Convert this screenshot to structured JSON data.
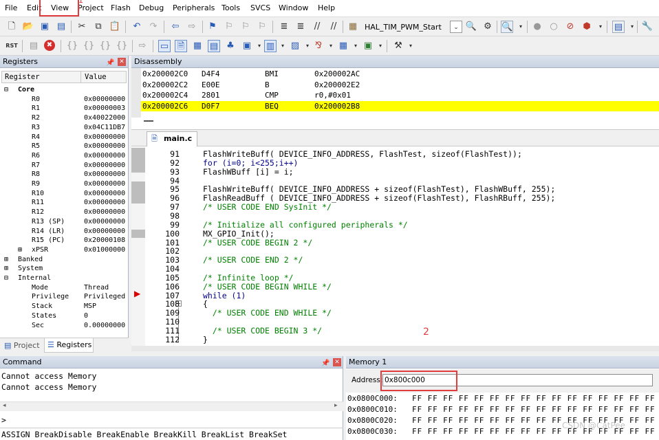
{
  "menu": {
    "items": [
      "File",
      "Edit",
      "View",
      "Project",
      "Flash",
      "Debug",
      "Peripherals",
      "Tools",
      "SVCS",
      "Window",
      "Help"
    ],
    "annotation_1": "1"
  },
  "toolbar": {
    "target_name": "HAL_TIM_PWM_Start"
  },
  "registers_panel": {
    "title": "Registers",
    "col_register": "Register",
    "col_value": "Value",
    "rows": [
      {
        "name": "Core",
        "value": "",
        "type": "group-open"
      },
      {
        "name": "R0",
        "value": "0x00000000"
      },
      {
        "name": "R1",
        "value": "0x00000003"
      },
      {
        "name": "R2",
        "value": "0x40022000"
      },
      {
        "name": "R3",
        "value": "0x04C11DB7"
      },
      {
        "name": "R4",
        "value": "0x00000000"
      },
      {
        "name": "R5",
        "value": "0x00000000"
      },
      {
        "name": "R6",
        "value": "0x00000000"
      },
      {
        "name": "R7",
        "value": "0x00000000"
      },
      {
        "name": "R8",
        "value": "0x00000000"
      },
      {
        "name": "R9",
        "value": "0x00000000"
      },
      {
        "name": "R10",
        "value": "0x00000000"
      },
      {
        "name": "R11",
        "value": "0x00000000"
      },
      {
        "name": "R12",
        "value": "0x00000000"
      },
      {
        "name": "R13 (SP)",
        "value": "0x00000000"
      },
      {
        "name": "R14 (LR)",
        "value": "0x00000000"
      },
      {
        "name": "R15 (PC)",
        "value": "0x20000108"
      },
      {
        "name": "xPSR",
        "value": "0x01000000"
      },
      {
        "name": "Banked",
        "value": ""
      },
      {
        "name": "System",
        "value": ""
      },
      {
        "name": "Internal",
        "value": ""
      },
      {
        "name": "Mode",
        "value": "Thread"
      },
      {
        "name": "Privilege",
        "value": "Privileged"
      },
      {
        "name": "Stack",
        "value": "MSP"
      },
      {
        "name": "States",
        "value": "0"
      },
      {
        "name": "Sec",
        "value": "0.00000000"
      }
    ],
    "tab_project": "Project",
    "tab_registers": "Registers"
  },
  "disassembly": {
    "title": "Disassembly",
    "rows": [
      {
        "addr": "0x200002C0",
        "op": "D4F4",
        "mnem": "BMI",
        "arg": "0x200002AC",
        "highlight": false
      },
      {
        "addr": "0x200002C2",
        "op": "E00E",
        "mnem": "B",
        "arg": "0x200002E2",
        "highlight": false
      },
      {
        "addr": "0x200002C4",
        "op": "2801",
        "mnem": "CMP",
        "arg": "r0,#0x01",
        "highlight": false
      },
      {
        "addr": "0x200002C6",
        "op": "D0F7",
        "mnem": "BEQ",
        "arg": "0x200002B8",
        "highlight": true
      }
    ]
  },
  "editor": {
    "tab": "main.c",
    "lines": [
      {
        "n": "91",
        "t": "FlashWriteBuff( DEVICE_INFO_ADDRESS, FlashTest, sizeof(FlashTest));"
      },
      {
        "n": "92",
        "t": "for (i=0; i<255;i++)"
      },
      {
        "n": "93",
        "t": "FlashWBuff [i] = i;"
      },
      {
        "n": "94",
        "t": ""
      },
      {
        "n": "95",
        "t": "FlashWriteBuff( DEVICE_INFO_ADDRESS + sizeof(FlashTest), FlashWBuff, 255);"
      },
      {
        "n": "96",
        "t": "FlashReadBuff ( DEVICE_INFO_ADDRESS + sizeof(FlashTest), FlashRBuff, 255);"
      },
      {
        "n": "97",
        "t": "/* USER CODE END SysInit */"
      },
      {
        "n": "98",
        "t": ""
      },
      {
        "n": "99",
        "t": "/* Initialize all configured peripherals */"
      },
      {
        "n": "100",
        "t": "MX_GPIO_Init();"
      },
      {
        "n": "101",
        "t": "/* USER CODE BEGIN 2 */"
      },
      {
        "n": "102",
        "t": ""
      },
      {
        "n": "103",
        "t": "/* USER CODE END 2 */"
      },
      {
        "n": "104",
        "t": ""
      },
      {
        "n": "105",
        "t": "/* Infinite loop */"
      },
      {
        "n": "106",
        "t": "/* USER CODE BEGIN WHILE */"
      },
      {
        "n": "107",
        "t": "while (1)"
      },
      {
        "n": "108",
        "t": "{"
      },
      {
        "n": "109",
        "t": "  /* USER CODE END WHILE */"
      },
      {
        "n": "110",
        "t": ""
      },
      {
        "n": "111",
        "t": "  /* USER CODE BEGIN 3 */"
      },
      {
        "n": "112",
        "t": "}"
      }
    ],
    "annotation_2": "2"
  },
  "command": {
    "title": "Command",
    "lines": [
      "Cannot access Memory",
      "Cannot access Memory"
    ],
    "prompt": ">",
    "hint": "ASSIGN BreakDisable BreakEnable BreakKill BreakList BreakSet"
  },
  "memory": {
    "title": "Memory 1",
    "address_label": "Address:",
    "address_value": "0x800c000",
    "rows": [
      {
        "addr": "0x0800C000:",
        "bytes": "FF FF FF FF FF FF FF FF FF FF FF FF FF FF FF FF"
      },
      {
        "addr": "0x0800C010:",
        "bytes": "FF FF FF FF FF FF FF FF FF FF FF FF FF FF FF FF"
      },
      {
        "addr": "0x0800C020:",
        "bytes": "FF FF FF FF FF FF FF FF FF FF FF FF FF FF FF FF"
      },
      {
        "addr": "0x0800C030:",
        "bytes": "FF FF FF FF FF FF FF FF FF FF FF FF FF FF FF FF"
      }
    ],
    "watermark": "CSDN @CatPee"
  }
}
